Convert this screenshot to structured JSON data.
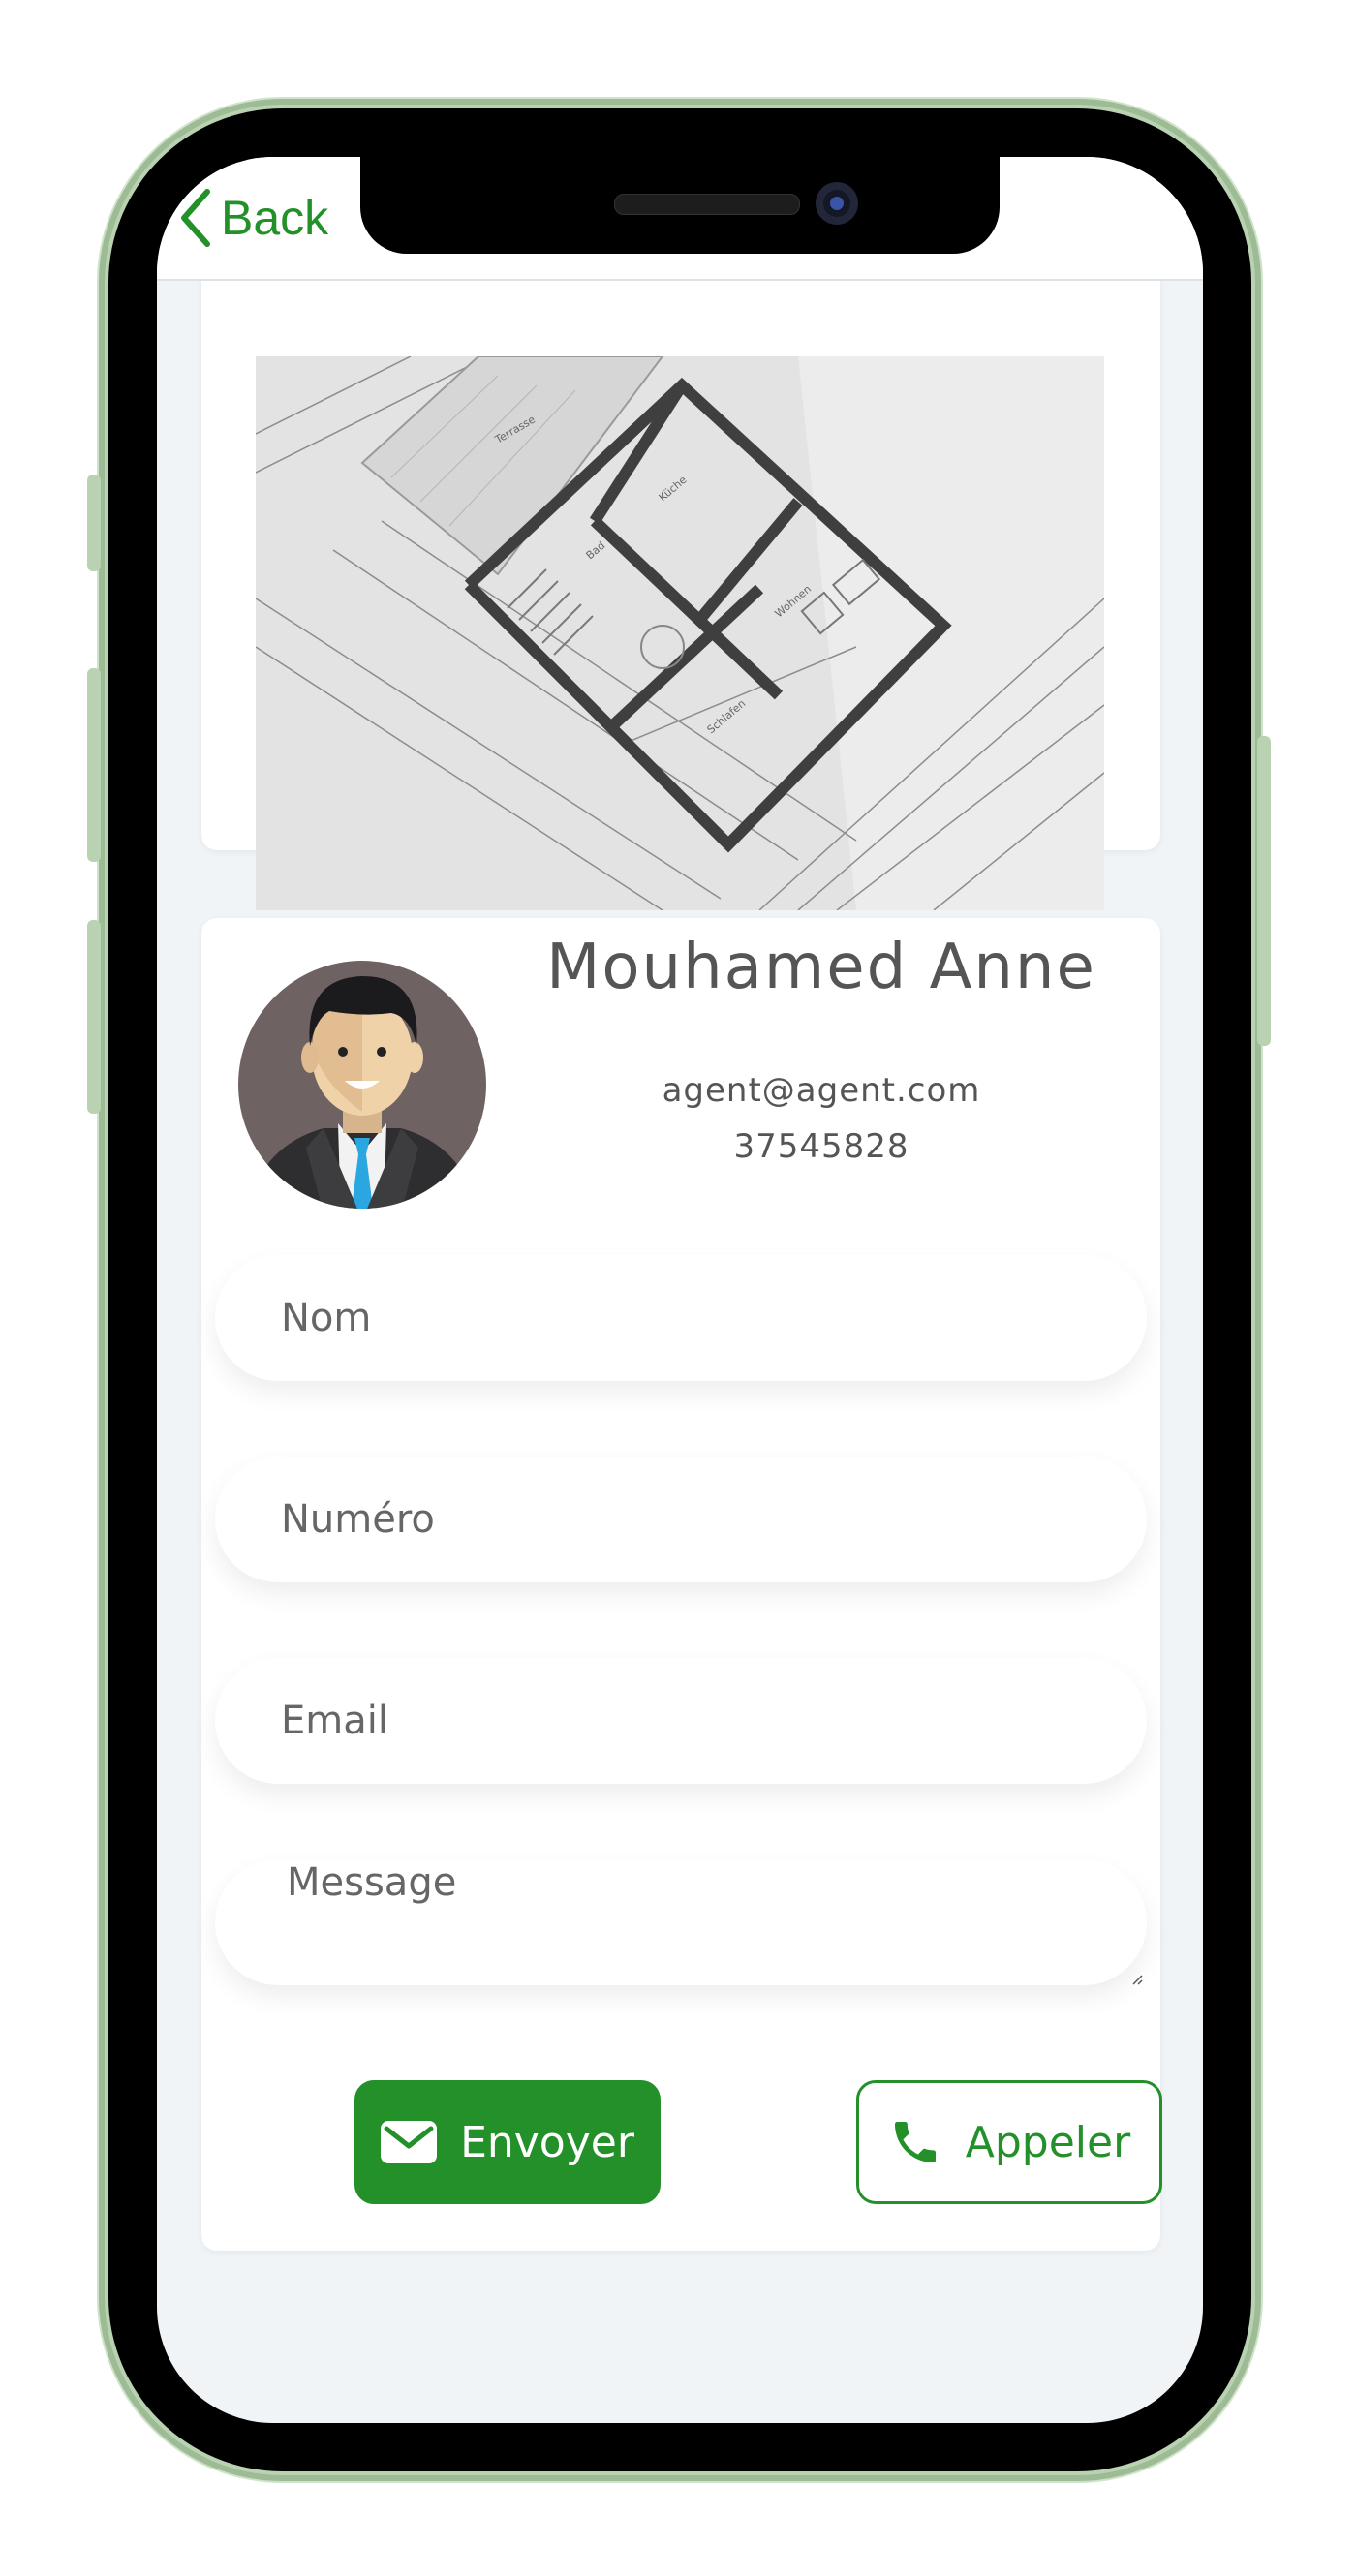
{
  "header": {
    "back_label": "Back"
  },
  "agent": {
    "name": "Mouhamed Anne",
    "email": "agent@agent.com",
    "phone": "37545828"
  },
  "form": {
    "nom_placeholder": "Nom",
    "numero_placeholder": "Numéro",
    "email_placeholder": "Email",
    "message_placeholder": "Message"
  },
  "actions": {
    "send_label": "Envoyer",
    "call_label": "Appeler"
  },
  "colors": {
    "accent": "#23902a",
    "text": "#555555",
    "background": "#f0f4f7"
  },
  "icons": [
    "chevron-left-icon",
    "mail-icon",
    "phone-icon"
  ]
}
